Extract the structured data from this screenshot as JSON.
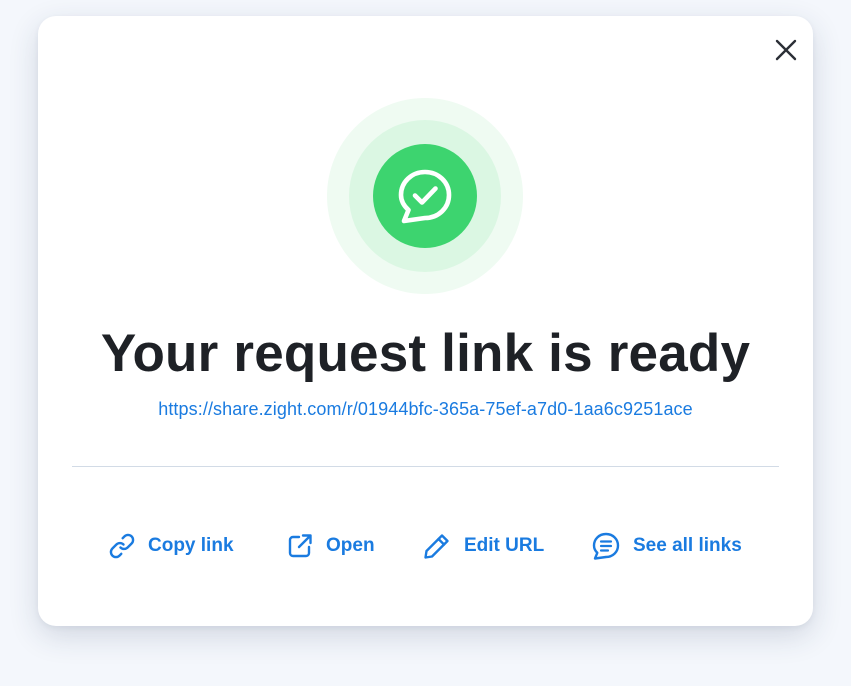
{
  "dialog": {
    "title": "Your request link is ready",
    "link_url": "https://share.zight.com/r/01944bfc-365a-75ef-a7d0-1aa6c9251ace",
    "close_icon": "close-icon",
    "status_icon": "chat-check-icon"
  },
  "actions": [
    {
      "label": "Copy link",
      "icon": "link-icon"
    },
    {
      "label": "Open",
      "icon": "external-link-icon"
    },
    {
      "label": "Edit URL",
      "icon": "pencil-icon"
    },
    {
      "label": "See all links",
      "icon": "list-bubble-icon"
    }
  ],
  "colors": {
    "accent": "#1a7be0",
    "success": "#3dd46f",
    "title": "#1e2126",
    "divider": "#d2dbe6"
  }
}
